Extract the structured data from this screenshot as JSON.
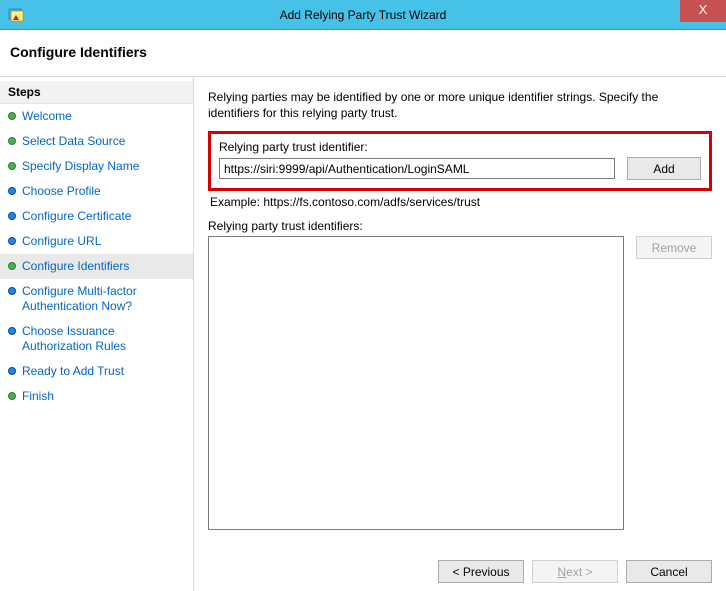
{
  "window": {
    "title": "Add Relying Party Trust Wizard",
    "close_label": "X"
  },
  "header": {
    "title": "Configure Identifiers"
  },
  "sidebar": {
    "title": "Steps",
    "items": [
      {
        "label": "Welcome",
        "color": "green",
        "active": false
      },
      {
        "label": "Select Data Source",
        "color": "green",
        "active": false
      },
      {
        "label": "Specify Display Name",
        "color": "green",
        "active": false
      },
      {
        "label": "Choose Profile",
        "color": "blue",
        "active": false
      },
      {
        "label": "Configure Certificate",
        "color": "blue",
        "active": false
      },
      {
        "label": "Configure URL",
        "color": "blue",
        "active": false
      },
      {
        "label": "Configure Identifiers",
        "color": "green",
        "active": true
      },
      {
        "label": "Configure Multi-factor Authentication Now?",
        "color": "blue",
        "active": false
      },
      {
        "label": "Choose Issuance Authorization Rules",
        "color": "blue",
        "active": false
      },
      {
        "label": "Ready to Add Trust",
        "color": "blue",
        "active": false
      },
      {
        "label": "Finish",
        "color": "green",
        "active": false
      }
    ]
  },
  "main": {
    "description": "Relying parties may be identified by one or more unique identifier strings. Specify the identifiers for this relying party trust.",
    "identifier_label": "Relying party trust identifier:",
    "identifier_value": "https://siri:9999/api/Authentication/LoginSAML",
    "add_label": "Add",
    "example_text": "Example: https://fs.contoso.com/adfs/services/trust",
    "identifiers_label": "Relying party trust identifiers:",
    "remove_label": "Remove"
  },
  "footer": {
    "previous": "< Previous",
    "next_prefix": "N",
    "next_suffix": "ext >",
    "cancel": "Cancel"
  }
}
